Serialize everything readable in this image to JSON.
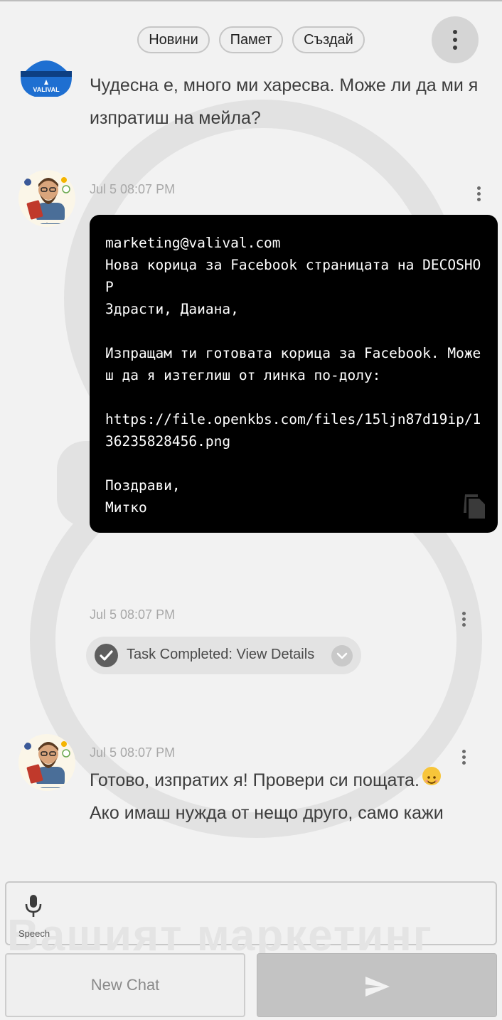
{
  "top_pills": [
    {
      "label": "Новини"
    },
    {
      "label": "Памет"
    },
    {
      "label": "Създай"
    }
  ],
  "user_message": {
    "text": "Чудесна е, много ми харесва. Може ли да ми я изпратиш на мейла?",
    "avatar_logo_text": "VALIVAL"
  },
  "bot_message_1": {
    "timestamp": "Jul 5 08:07 PM",
    "code_text": "marketing@valival.com\nНова корица за Facebook страницата на DECOSHOP\nЗдрасти, Даиана,\n\nИзпращам ти готовата корица за Facebook. Можеш да я изтеглиш от линка по-долу:\n\nhttps://file.openkbs.com/files/15ljn87d19ip/136235828456.png\n\nПоздрави,\nМитко"
  },
  "task_message": {
    "timestamp": "Jul 5 08:07 PM",
    "label": "Task Completed: View Details"
  },
  "bot_message_2": {
    "timestamp": "Jul 5 08:07 PM",
    "line1": "Готово, изпратих я! Провери си пощата.",
    "line2": "Ако имаш нужда от нещо друго, само кажи"
  },
  "input": {
    "speech_label": "Speech",
    "watermark": "Вашият маркетинг"
  },
  "buttons": {
    "new_chat": "New Chat"
  },
  "icons": {
    "menu": "more-vert-icon",
    "copy": "copy-icon",
    "check": "check-circle-icon",
    "chevron": "chevron-down-icon",
    "mic": "mic-icon",
    "send": "send-icon",
    "emoji": "smiley-emoji"
  }
}
